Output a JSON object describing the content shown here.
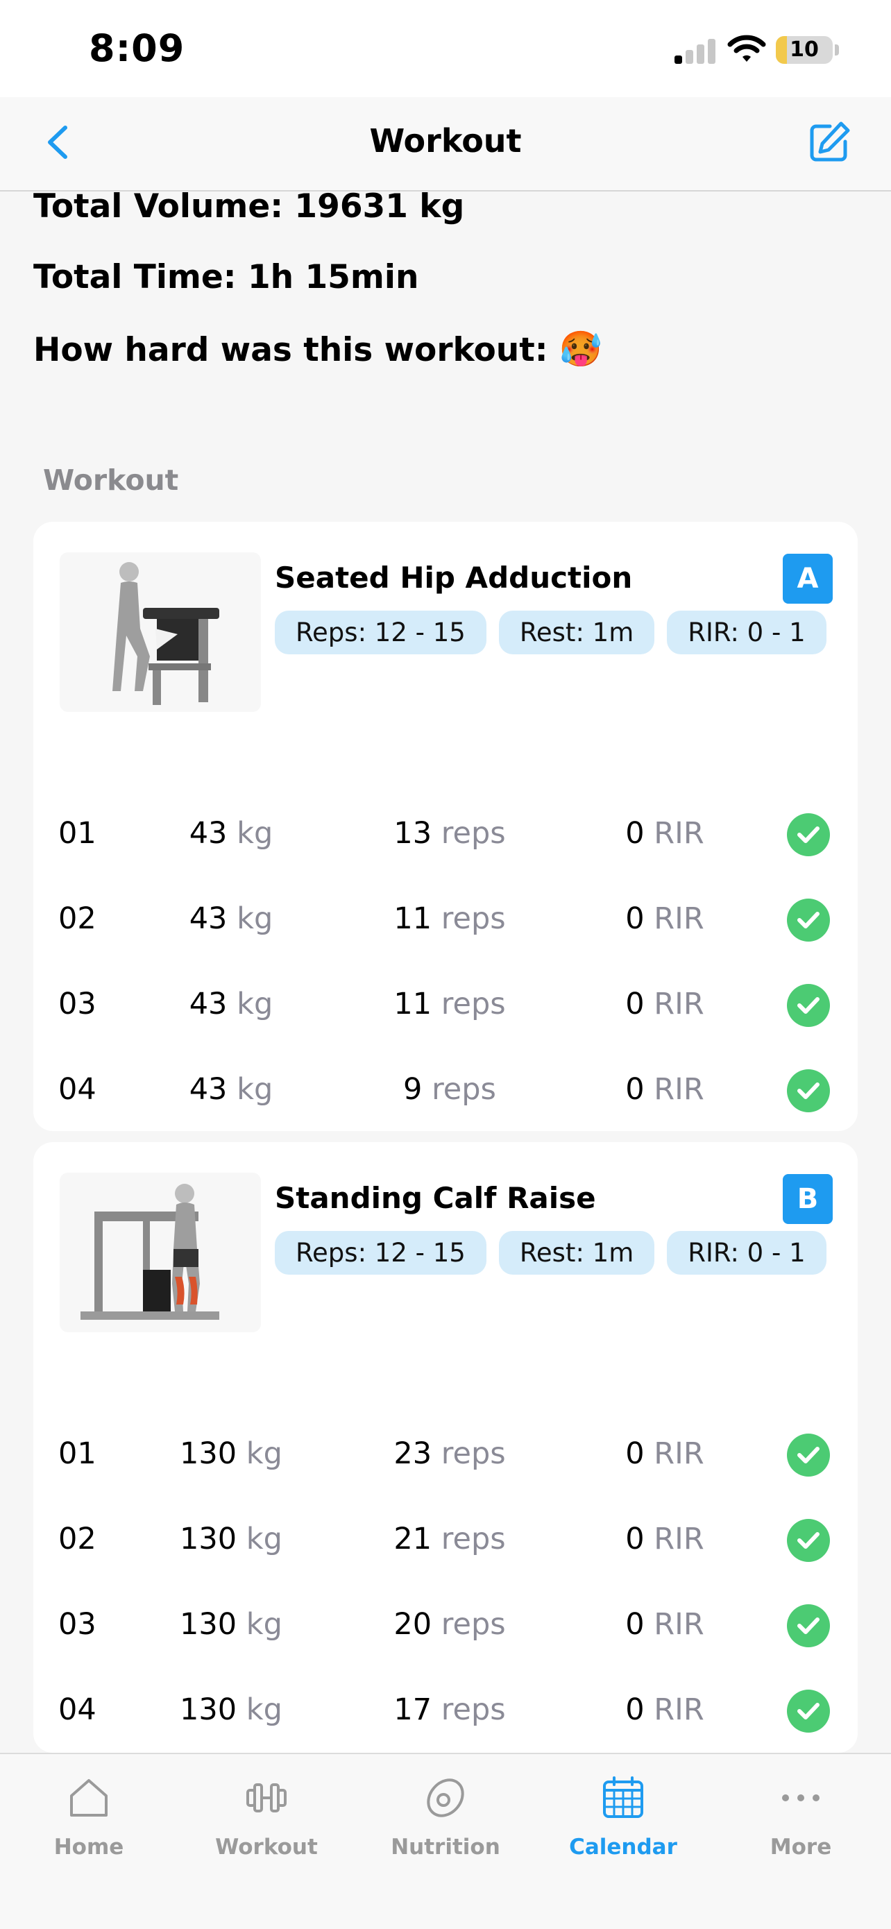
{
  "status_bar": {
    "time": "8:09",
    "battery": "10"
  },
  "nav": {
    "title": "Workout"
  },
  "summary": {
    "total_volume": "Total Volume: 19631 kg",
    "total_time": "Total Time: 1h 15min",
    "difficulty_label": "How hard was this workout:",
    "difficulty_emoji": "🥵"
  },
  "section_title": "Workout",
  "exercises": [
    {
      "name": "Seated Hip Adduction",
      "badge": "A",
      "reps_pill": "Reps: 12 - 15",
      "rest_pill": "Rest: 1m",
      "rir_pill": "RIR: 0 - 1",
      "sets": [
        {
          "num": "01",
          "weight": "43",
          "reps": "13",
          "rir": "0"
        },
        {
          "num": "02",
          "weight": "43",
          "reps": "11",
          "rir": "0"
        },
        {
          "num": "03",
          "weight": "43",
          "reps": "11",
          "rir": "0"
        },
        {
          "num": "04",
          "weight": "43",
          "reps": "9",
          "rir": "0"
        }
      ]
    },
    {
      "name": "Standing Calf Raise",
      "badge": "B",
      "reps_pill": "Reps: 12 - 15",
      "rest_pill": "Rest: 1m",
      "rir_pill": "RIR: 0 - 1",
      "sets": [
        {
          "num": "01",
          "weight": "130",
          "reps": "23",
          "rir": "0"
        },
        {
          "num": "02",
          "weight": "130",
          "reps": "21",
          "rir": "0"
        },
        {
          "num": "03",
          "weight": "130",
          "reps": "20",
          "rir": "0"
        },
        {
          "num": "04",
          "weight": "130",
          "reps": "17",
          "rir": "0"
        }
      ]
    }
  ],
  "units": {
    "weight": "kg",
    "reps": "reps",
    "rir": "RIR"
  },
  "tabs": [
    {
      "label": "Home",
      "icon": "home-icon"
    },
    {
      "label": "Workout",
      "icon": "dumbbell-icon"
    },
    {
      "label": "Nutrition",
      "icon": "avocado-icon"
    },
    {
      "label": "Calendar",
      "icon": "calendar-icon",
      "active": true
    },
    {
      "label": "More",
      "icon": "more-icon"
    }
  ],
  "colors": {
    "accent": "#1e9bf0",
    "check_green": "#4ccb73",
    "pill_bg": "#d5ecfa"
  }
}
